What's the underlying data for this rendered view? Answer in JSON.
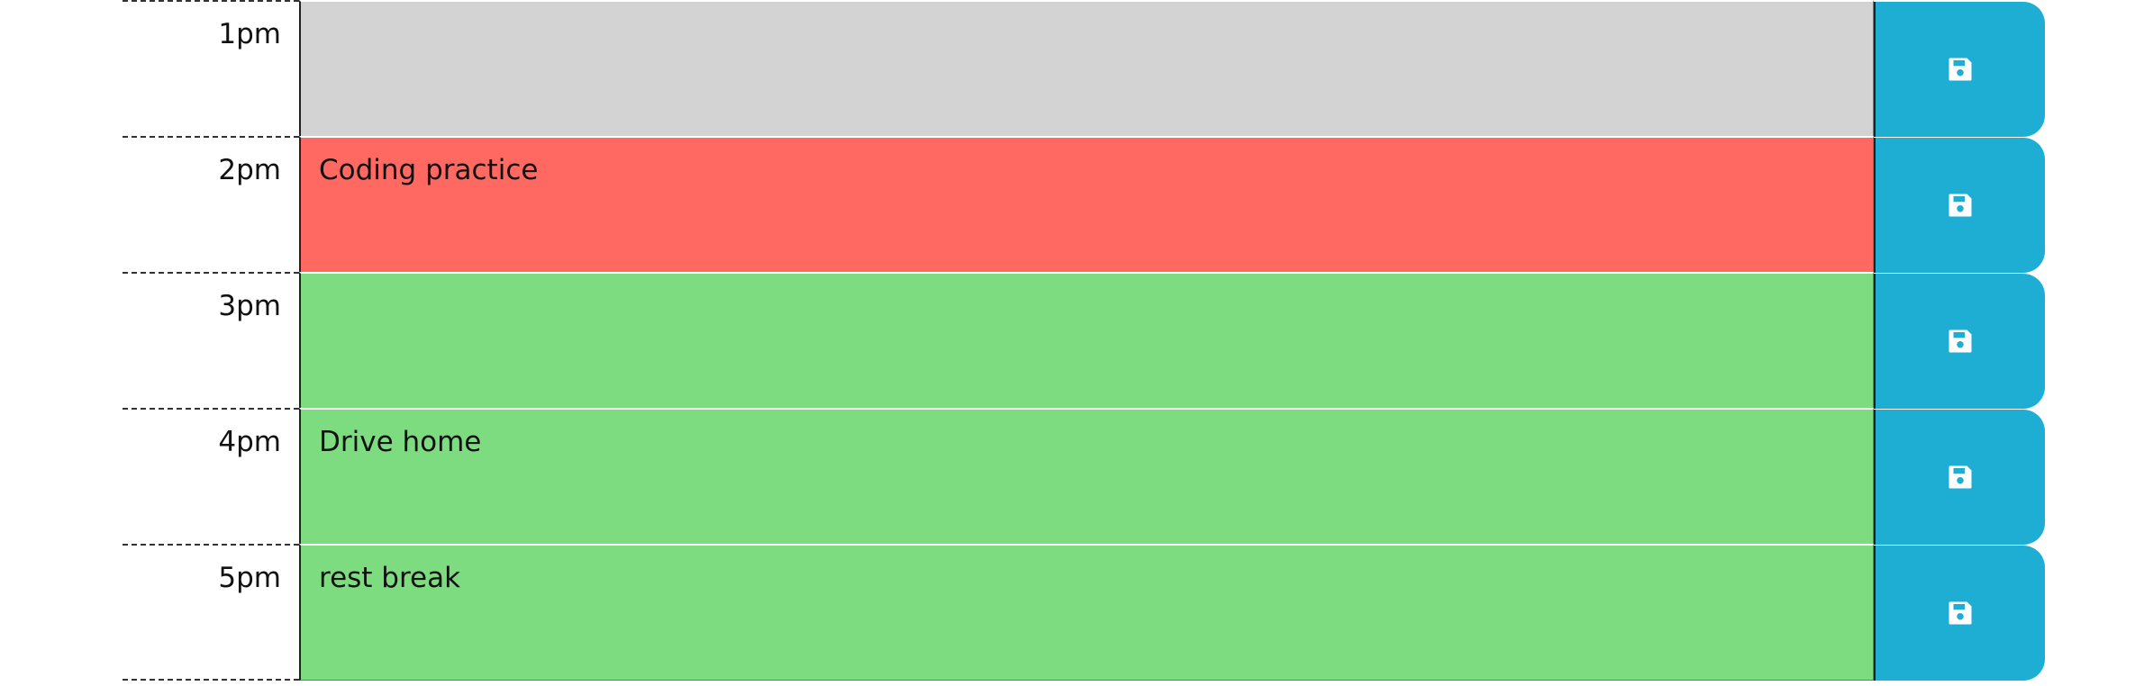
{
  "colors": {
    "past": "#d3d3d3",
    "present": "#ff6961",
    "future": "#7ddc80",
    "save_button": "#1eaed4"
  },
  "rows": [
    {
      "hour": "1pm",
      "text": "",
      "state": "past",
      "icon": "floppy-disk-icon"
    },
    {
      "hour": "2pm",
      "text": "Coding practice",
      "state": "present",
      "icon": "floppy-disk-icon"
    },
    {
      "hour": "3pm",
      "text": "",
      "state": "future",
      "icon": "floppy-disk-icon"
    },
    {
      "hour": "4pm",
      "text": "Drive home",
      "state": "future",
      "icon": "floppy-disk-icon"
    },
    {
      "hour": "5pm",
      "text": "rest break",
      "state": "future",
      "icon": "floppy-disk-icon"
    }
  ]
}
